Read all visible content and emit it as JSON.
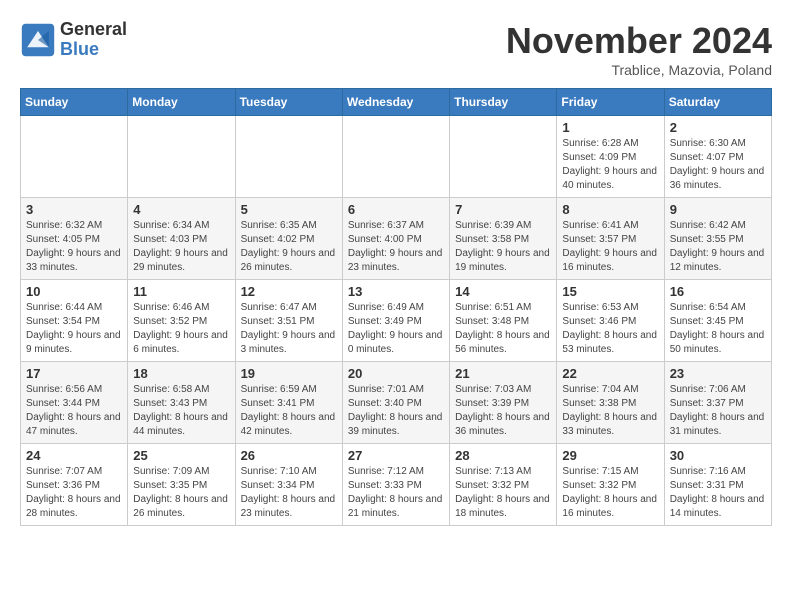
{
  "logo": {
    "general": "General",
    "blue": "Blue"
  },
  "title": "November 2024",
  "location": "Trablice, Mazovia, Poland",
  "days_of_week": [
    "Sunday",
    "Monday",
    "Tuesday",
    "Wednesday",
    "Thursday",
    "Friday",
    "Saturday"
  ],
  "weeks": [
    [
      {
        "day": "",
        "info": ""
      },
      {
        "day": "",
        "info": ""
      },
      {
        "day": "",
        "info": ""
      },
      {
        "day": "",
        "info": ""
      },
      {
        "day": "",
        "info": ""
      },
      {
        "day": "1",
        "info": "Sunrise: 6:28 AM\nSunset: 4:09 PM\nDaylight: 9 hours and 40 minutes."
      },
      {
        "day": "2",
        "info": "Sunrise: 6:30 AM\nSunset: 4:07 PM\nDaylight: 9 hours and 36 minutes."
      }
    ],
    [
      {
        "day": "3",
        "info": "Sunrise: 6:32 AM\nSunset: 4:05 PM\nDaylight: 9 hours and 33 minutes."
      },
      {
        "day": "4",
        "info": "Sunrise: 6:34 AM\nSunset: 4:03 PM\nDaylight: 9 hours and 29 minutes."
      },
      {
        "day": "5",
        "info": "Sunrise: 6:35 AM\nSunset: 4:02 PM\nDaylight: 9 hours and 26 minutes."
      },
      {
        "day": "6",
        "info": "Sunrise: 6:37 AM\nSunset: 4:00 PM\nDaylight: 9 hours and 23 minutes."
      },
      {
        "day": "7",
        "info": "Sunrise: 6:39 AM\nSunset: 3:58 PM\nDaylight: 9 hours and 19 minutes."
      },
      {
        "day": "8",
        "info": "Sunrise: 6:41 AM\nSunset: 3:57 PM\nDaylight: 9 hours and 16 minutes."
      },
      {
        "day": "9",
        "info": "Sunrise: 6:42 AM\nSunset: 3:55 PM\nDaylight: 9 hours and 12 minutes."
      }
    ],
    [
      {
        "day": "10",
        "info": "Sunrise: 6:44 AM\nSunset: 3:54 PM\nDaylight: 9 hours and 9 minutes."
      },
      {
        "day": "11",
        "info": "Sunrise: 6:46 AM\nSunset: 3:52 PM\nDaylight: 9 hours and 6 minutes."
      },
      {
        "day": "12",
        "info": "Sunrise: 6:47 AM\nSunset: 3:51 PM\nDaylight: 9 hours and 3 minutes."
      },
      {
        "day": "13",
        "info": "Sunrise: 6:49 AM\nSunset: 3:49 PM\nDaylight: 9 hours and 0 minutes."
      },
      {
        "day": "14",
        "info": "Sunrise: 6:51 AM\nSunset: 3:48 PM\nDaylight: 8 hours and 56 minutes."
      },
      {
        "day": "15",
        "info": "Sunrise: 6:53 AM\nSunset: 3:46 PM\nDaylight: 8 hours and 53 minutes."
      },
      {
        "day": "16",
        "info": "Sunrise: 6:54 AM\nSunset: 3:45 PM\nDaylight: 8 hours and 50 minutes."
      }
    ],
    [
      {
        "day": "17",
        "info": "Sunrise: 6:56 AM\nSunset: 3:44 PM\nDaylight: 8 hours and 47 minutes."
      },
      {
        "day": "18",
        "info": "Sunrise: 6:58 AM\nSunset: 3:43 PM\nDaylight: 8 hours and 44 minutes."
      },
      {
        "day": "19",
        "info": "Sunrise: 6:59 AM\nSunset: 3:41 PM\nDaylight: 8 hours and 42 minutes."
      },
      {
        "day": "20",
        "info": "Sunrise: 7:01 AM\nSunset: 3:40 PM\nDaylight: 8 hours and 39 minutes."
      },
      {
        "day": "21",
        "info": "Sunrise: 7:03 AM\nSunset: 3:39 PM\nDaylight: 8 hours and 36 minutes."
      },
      {
        "day": "22",
        "info": "Sunrise: 7:04 AM\nSunset: 3:38 PM\nDaylight: 8 hours and 33 minutes."
      },
      {
        "day": "23",
        "info": "Sunrise: 7:06 AM\nSunset: 3:37 PM\nDaylight: 8 hours and 31 minutes."
      }
    ],
    [
      {
        "day": "24",
        "info": "Sunrise: 7:07 AM\nSunset: 3:36 PM\nDaylight: 8 hours and 28 minutes."
      },
      {
        "day": "25",
        "info": "Sunrise: 7:09 AM\nSunset: 3:35 PM\nDaylight: 8 hours and 26 minutes."
      },
      {
        "day": "26",
        "info": "Sunrise: 7:10 AM\nSunset: 3:34 PM\nDaylight: 8 hours and 23 minutes."
      },
      {
        "day": "27",
        "info": "Sunrise: 7:12 AM\nSunset: 3:33 PM\nDaylight: 8 hours and 21 minutes."
      },
      {
        "day": "28",
        "info": "Sunrise: 7:13 AM\nSunset: 3:32 PM\nDaylight: 8 hours and 18 minutes."
      },
      {
        "day": "29",
        "info": "Sunrise: 7:15 AM\nSunset: 3:32 PM\nDaylight: 8 hours and 16 minutes."
      },
      {
        "day": "30",
        "info": "Sunrise: 7:16 AM\nSunset: 3:31 PM\nDaylight: 8 hours and 14 minutes."
      }
    ]
  ]
}
